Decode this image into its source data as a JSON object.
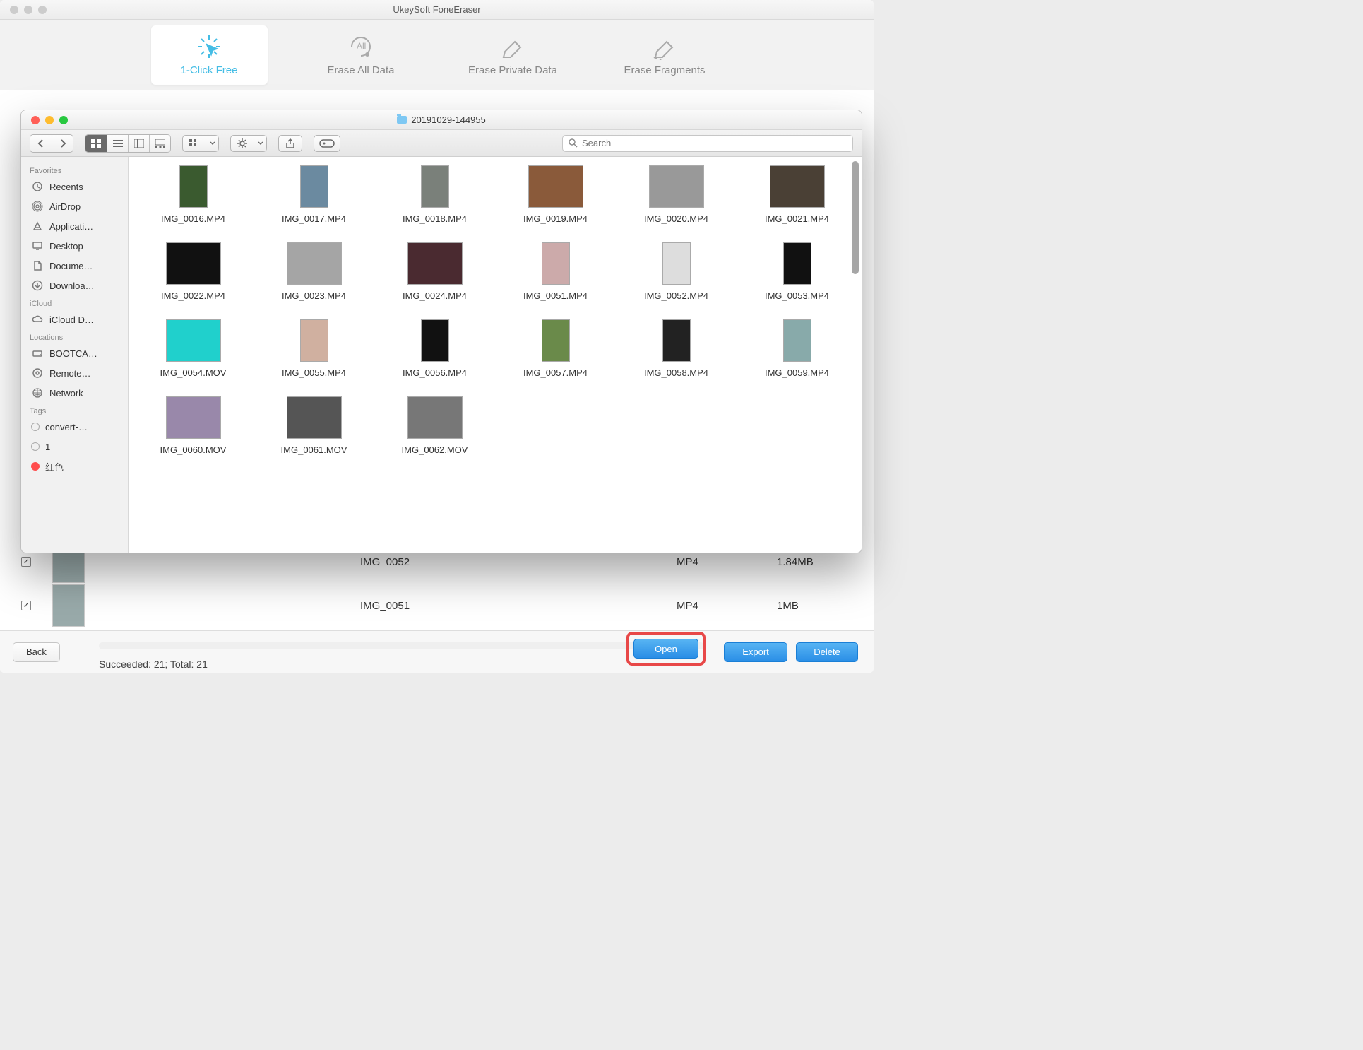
{
  "app": {
    "title": "UkeySoft FoneEraser"
  },
  "tabs": [
    {
      "label": "1-Click Free",
      "active": true,
      "icon": "click-free-icon"
    },
    {
      "label": "Erase All Data",
      "active": false,
      "icon": "erase-all-icon"
    },
    {
      "label": "Erase Private Data",
      "active": false,
      "icon": "erase-private-icon"
    },
    {
      "label": "Erase Fragments",
      "active": false,
      "icon": "erase-fragments-icon"
    }
  ],
  "bg_rows": [
    {
      "name": "IMG_0052",
      "type": "MP4",
      "size": "1.84MB"
    },
    {
      "name": "IMG_0051",
      "type": "MP4",
      "size": "1MB"
    }
  ],
  "bottom": {
    "back": "Back",
    "open": "Open",
    "export": "Export",
    "delete": "Delete",
    "status": "Succeeded: 21; Total: 21"
  },
  "finder": {
    "folder_name": "20191029-144955",
    "search_placeholder": "Search",
    "sidebar": {
      "favorites_label": "Favorites",
      "favorites": [
        {
          "label": "Recents",
          "icon": "recents-icon"
        },
        {
          "label": "AirDrop",
          "icon": "airdrop-icon"
        },
        {
          "label": "Applicati…",
          "icon": "applications-icon"
        },
        {
          "label": "Desktop",
          "icon": "desktop-icon"
        },
        {
          "label": "Docume…",
          "icon": "documents-icon"
        },
        {
          "label": "Downloa…",
          "icon": "downloads-icon"
        }
      ],
      "icloud_label": "iCloud",
      "icloud": [
        {
          "label": "iCloud D…",
          "icon": "icloud-icon"
        }
      ],
      "locations_label": "Locations",
      "locations": [
        {
          "label": "BOOTCA…",
          "icon": "drive-icon"
        },
        {
          "label": "Remote…",
          "icon": "remote-disc-icon"
        },
        {
          "label": "Network",
          "icon": "network-icon"
        }
      ],
      "tags_label": "Tags",
      "tags": [
        {
          "label": "convert-…",
          "color": ""
        },
        {
          "label": "1",
          "color": ""
        },
        {
          "label": "红色",
          "color": "red"
        }
      ]
    },
    "files": [
      {
        "name": "IMG_0016.MP4",
        "shape": "port",
        "bg": "#3a5a2f"
      },
      {
        "name": "IMG_0017.MP4",
        "shape": "port",
        "bg": "#6b8aa0"
      },
      {
        "name": "IMG_0018.MP4",
        "shape": "port",
        "bg": "#7a807a"
      },
      {
        "name": "IMG_0019.MP4",
        "shape": "land",
        "bg": "#8a5a3a"
      },
      {
        "name": "IMG_0020.MP4",
        "shape": "land",
        "bg": "#999"
      },
      {
        "name": "IMG_0021.MP4",
        "shape": "land",
        "bg": "#4a4035"
      },
      {
        "name": "IMG_0022.MP4",
        "shape": "land",
        "bg": "#111"
      },
      {
        "name": "IMG_0023.MP4",
        "shape": "land",
        "bg": "#a5a5a5"
      },
      {
        "name": "IMG_0024.MP4",
        "shape": "land",
        "bg": "#4a2a30"
      },
      {
        "name": "IMG_0051.MP4",
        "shape": "port",
        "bg": "#caa"
      },
      {
        "name": "IMG_0052.MP4",
        "shape": "port",
        "bg": "#ddd"
      },
      {
        "name": "IMG_0053.MP4",
        "shape": "port",
        "bg": "#111"
      },
      {
        "name": "IMG_0054.MOV",
        "shape": "land",
        "bg": "#20d0cc"
      },
      {
        "name": "IMG_0055.MP4",
        "shape": "port",
        "bg": "#d0b0a0"
      },
      {
        "name": "IMG_0056.MP4",
        "shape": "port",
        "bg": "#111"
      },
      {
        "name": "IMG_0057.MP4",
        "shape": "port",
        "bg": "#6a8a4a"
      },
      {
        "name": "IMG_0058.MP4",
        "shape": "port",
        "bg": "#222"
      },
      {
        "name": "IMG_0059.MP4",
        "shape": "port",
        "bg": "#8aa"
      },
      {
        "name": "IMG_0060.MOV",
        "shape": "land",
        "bg": "#98a"
      },
      {
        "name": "IMG_0061.MOV",
        "shape": "land",
        "bg": "#555"
      },
      {
        "name": "IMG_0062.MOV",
        "shape": "land",
        "bg": "#777"
      }
    ]
  }
}
